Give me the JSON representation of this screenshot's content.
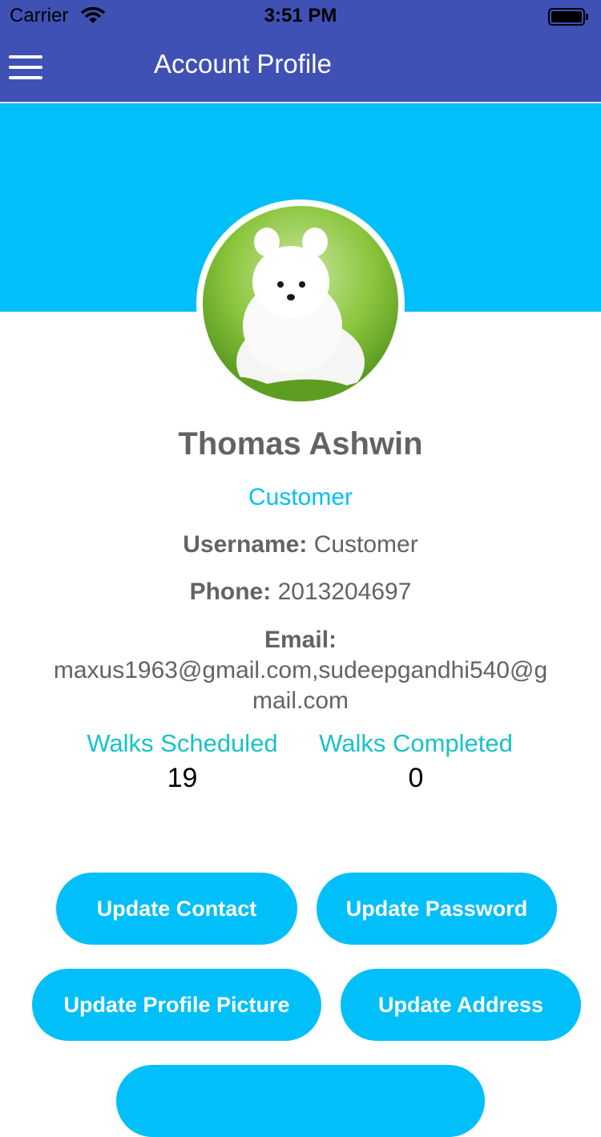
{
  "status_bar": {
    "carrier": "Carrier",
    "time": "3:51 PM"
  },
  "nav": {
    "title": "Account Profile",
    "menu_icon": "hamburger-menu-icon"
  },
  "colors": {
    "nav": "#3f51b5",
    "banner": "#00bff9",
    "accent": "#00bff9",
    "stat_label": "#18c2c9",
    "text": "#636363"
  },
  "profile": {
    "name": "Thomas Ashwin",
    "role": "Customer",
    "username_label": "Username:",
    "username": "Customer",
    "phone_label": "Phone:",
    "phone": "2013204697",
    "email_label": "Email:",
    "email": "maxus1963@gmail.com,sudeepgandhi540@gmail.com"
  },
  "stats": [
    {
      "label": "Walks Scheduled",
      "value": "19"
    },
    {
      "label": "Walks Completed",
      "value": "0"
    }
  ],
  "buttons": {
    "update_contact": "Update Contact",
    "update_password": "Update Password",
    "update_profile_picture": "Update Profile Picture",
    "update_address": "Update Address"
  }
}
